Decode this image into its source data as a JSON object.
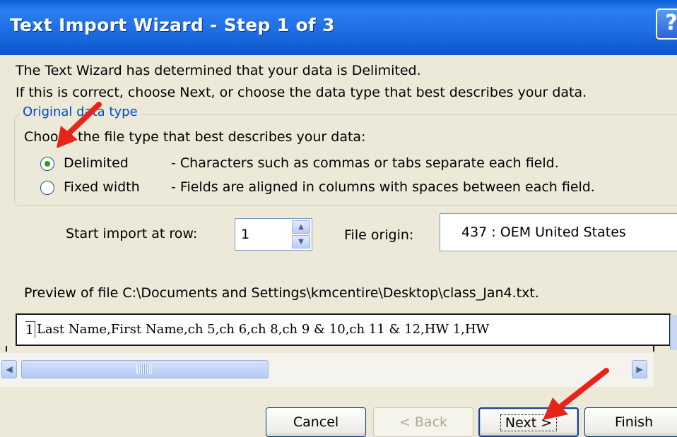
{
  "window": {
    "title": "Text Import Wizard - Step 1 of 3",
    "help_label": "?"
  },
  "intro": {
    "line1": "The Text Wizard has determined that your data is Delimited.",
    "line2": "If this is correct, choose Next, or choose the data type that best describes your data."
  },
  "original_data_type": {
    "legend": "Original data type",
    "prompt": "Choose the file type that best describes your data:",
    "options": [
      {
        "label": "Delimited",
        "description": "- Characters such as commas or tabs separate each field.",
        "selected": true
      },
      {
        "label": "Fixed width",
        "description": "- Fields are aligned in columns with spaces between each field.",
        "selected": false
      }
    ]
  },
  "import": {
    "start_row_label": "Start import at row:",
    "start_row_value": "1",
    "file_origin_label": "File origin:",
    "file_origin_value": "437 : OEM United States"
  },
  "preview": {
    "label": "Preview of file C:\\Documents and Settings\\kmcentire\\Desktop\\class_Jan4.txt.",
    "rows": [
      {
        "num": "1",
        "text": "Last Name,First Name,ch 5,ch 6,ch 8,ch 9 & 10,ch 11 & 12,HW 1,HW"
      }
    ],
    "scroll_grip": "III"
  },
  "buttons": {
    "cancel": "Cancel",
    "back": "< Back",
    "next": "Next >",
    "finish": "Finish"
  },
  "colors": {
    "title_bar": "#1f6ee6",
    "dialog_bg": "#ece9d8",
    "annotation_arrow": "#e8231a",
    "radio_dot": "#21a121"
  }
}
